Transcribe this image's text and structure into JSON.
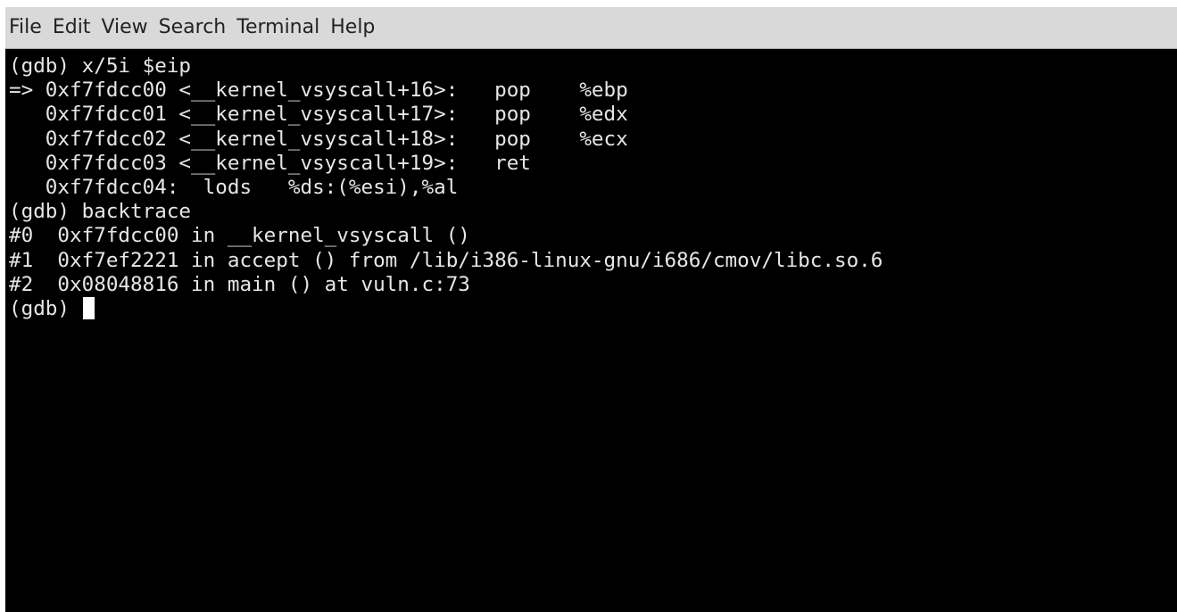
{
  "menubar": {
    "items": [
      "File",
      "Edit",
      "View",
      "Search",
      "Terminal",
      "Help"
    ]
  },
  "terminal": {
    "lines": [
      "(gdb) x/5i $eip",
      "=> 0xf7fdcc00 <__kernel_vsyscall+16>:   pop    %ebp",
      "   0xf7fdcc01 <__kernel_vsyscall+17>:   pop    %edx",
      "   0xf7fdcc02 <__kernel_vsyscall+18>:   pop    %ecx",
      "   0xf7fdcc03 <__kernel_vsyscall+19>:   ret",
      "   0xf7fdcc04:  lods   %ds:(%esi),%al",
      "(gdb) backtrace",
      "#0  0xf7fdcc00 in __kernel_vsyscall ()",
      "#1  0xf7ef2221 in accept () from /lib/i386-linux-gnu/i686/cmov/libc.so.6",
      "#2  0x08048816 in main () at vuln.c:73"
    ],
    "prompt": "(gdb) "
  }
}
